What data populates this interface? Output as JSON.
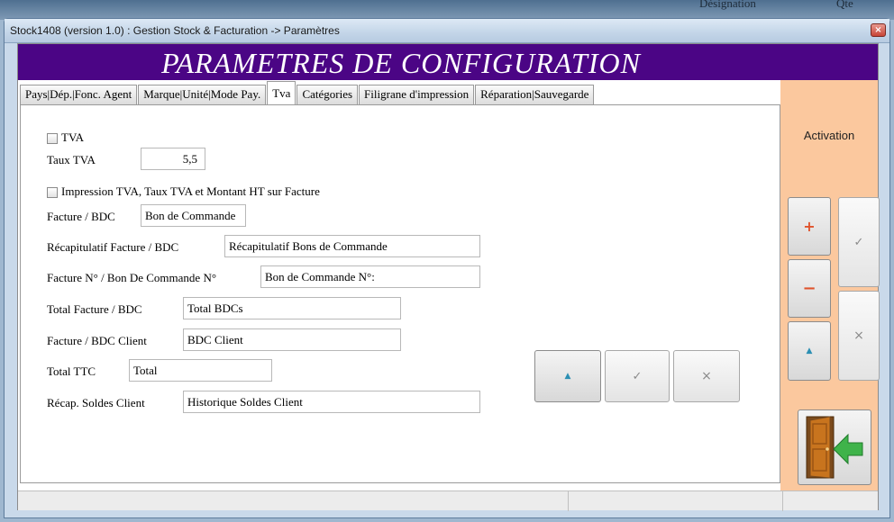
{
  "background": {
    "left_text": "",
    "right_text_1": "Désignation",
    "right_text_2": "Qte"
  },
  "window": {
    "title": "Stock1408 (version 1.0) : Gestion Stock & Facturation -> Paramètres",
    "close_glyph": "×"
  },
  "header": {
    "title": "PARAMETRES DE CONFIGURATION",
    "band_color": "#4b0585"
  },
  "tabs": [
    {
      "label": "Pays|Dép.|Fonc. Agent"
    },
    {
      "label": "Marque|Unité|Mode Pay."
    },
    {
      "label": "Tva",
      "active": true
    },
    {
      "label": "Catégories"
    },
    {
      "label": "Filigrane d'impression"
    },
    {
      "label": "Réparation|Sauvegarde"
    }
  ],
  "form": {
    "tva_checkbox_label": "TVA",
    "taux_tva_label": "Taux TVA",
    "taux_tva_value": "5,5",
    "impression_checkbox_label": "Impression TVA, Taux TVA et Montant HT sur Facture",
    "facture_bdc_label": "Facture / BDC",
    "facture_bdc_value": "Bon de Commande",
    "recap_facture_label": "Récapitulatif Facture / BDC",
    "recap_facture_value": "Récapitulatif Bons de Commande",
    "facture_num_label": "Facture N° / Bon De Commande N°",
    "facture_num_value": "Bon de Commande N°:",
    "total_facture_label": "Total Facture / BDC",
    "total_facture_value": "Total BDCs",
    "facture_client_label": "Facture / BDC Client",
    "facture_client_value": "BDC Client",
    "total_ttc_label": "Total TTC",
    "total_ttc_value": "Total",
    "recap_soldes_label": "Récap. Soldes Client",
    "recap_soldes_value": "Historique Soldes Client"
  },
  "sidebar": {
    "activation_label": "Activation",
    "panel_color": "#fbc89e"
  },
  "icons": {
    "add": "add-icon",
    "remove": "remove-icon",
    "up": "triangle-up-icon",
    "validate": "checkmark-icon",
    "cancel": "cross-icon",
    "exit": "exit-door-icon"
  },
  "glyphs": {
    "plus": "+",
    "minus": "−",
    "up": "▲",
    "check": "✓",
    "cross": "×"
  }
}
